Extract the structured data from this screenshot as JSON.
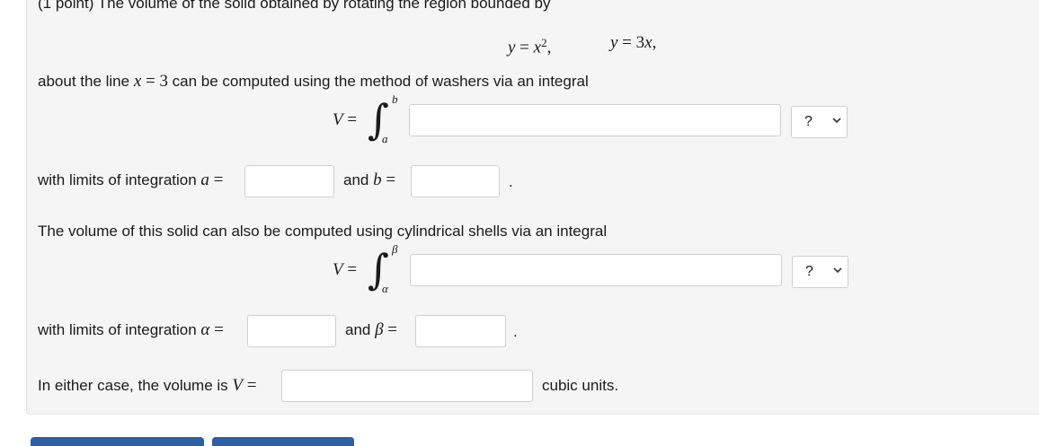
{
  "problem": {
    "intro_text": "(1 point) The volume of the solid obtained by rotating the region bounded by",
    "eq1_lhs": "y",
    "eq1_op": "=",
    "eq1_rhs_var": "x",
    "eq1_rhs_exp": "2",
    "eq1_sep": ",",
    "eq2_lhs": "y",
    "eq2_op": "=",
    "eq2_rhs_coef": "3",
    "eq2_rhs_var": "x",
    "eq2_sep": ",",
    "about_prefix": "about the line ",
    "about_var": "x",
    "about_op": "=",
    "about_val": "3",
    "about_suffix": " can be computed using the method of washers via an integral",
    "washers": {
      "V": "V",
      "eq": "=",
      "upper": "b",
      "lower": "a",
      "integrand_value": "",
      "select_value": "?"
    },
    "limits1": {
      "prefix": "with limits of integration ",
      "a_var": "a",
      "eq": "=",
      "a_value": "",
      "and": "and ",
      "b_var": "b",
      "b_value": "",
      "period": "."
    },
    "shells_text": "The volume of this solid can also be computed using cylindrical shells via an integral",
    "shells": {
      "V": "V",
      "eq": "=",
      "upper": "β",
      "lower": "α",
      "integrand_value": "",
      "select_value": "?"
    },
    "limits2": {
      "prefix": "with limits of integration ",
      "alpha_var": "α",
      "eq": "=",
      "alpha_value": "",
      "and": "and ",
      "beta_var": "β",
      "beta_value": "",
      "period": "."
    },
    "volume": {
      "prefix": "In either case, the volume is ",
      "V": "V",
      "eq": "=",
      "value": "",
      "units": "cubic units."
    }
  },
  "colors": {
    "panel_bg": "#f5f5f5",
    "button_blue": "#2b5fa6"
  },
  "icons": {
    "dropdown": "chevron-down-icon"
  }
}
